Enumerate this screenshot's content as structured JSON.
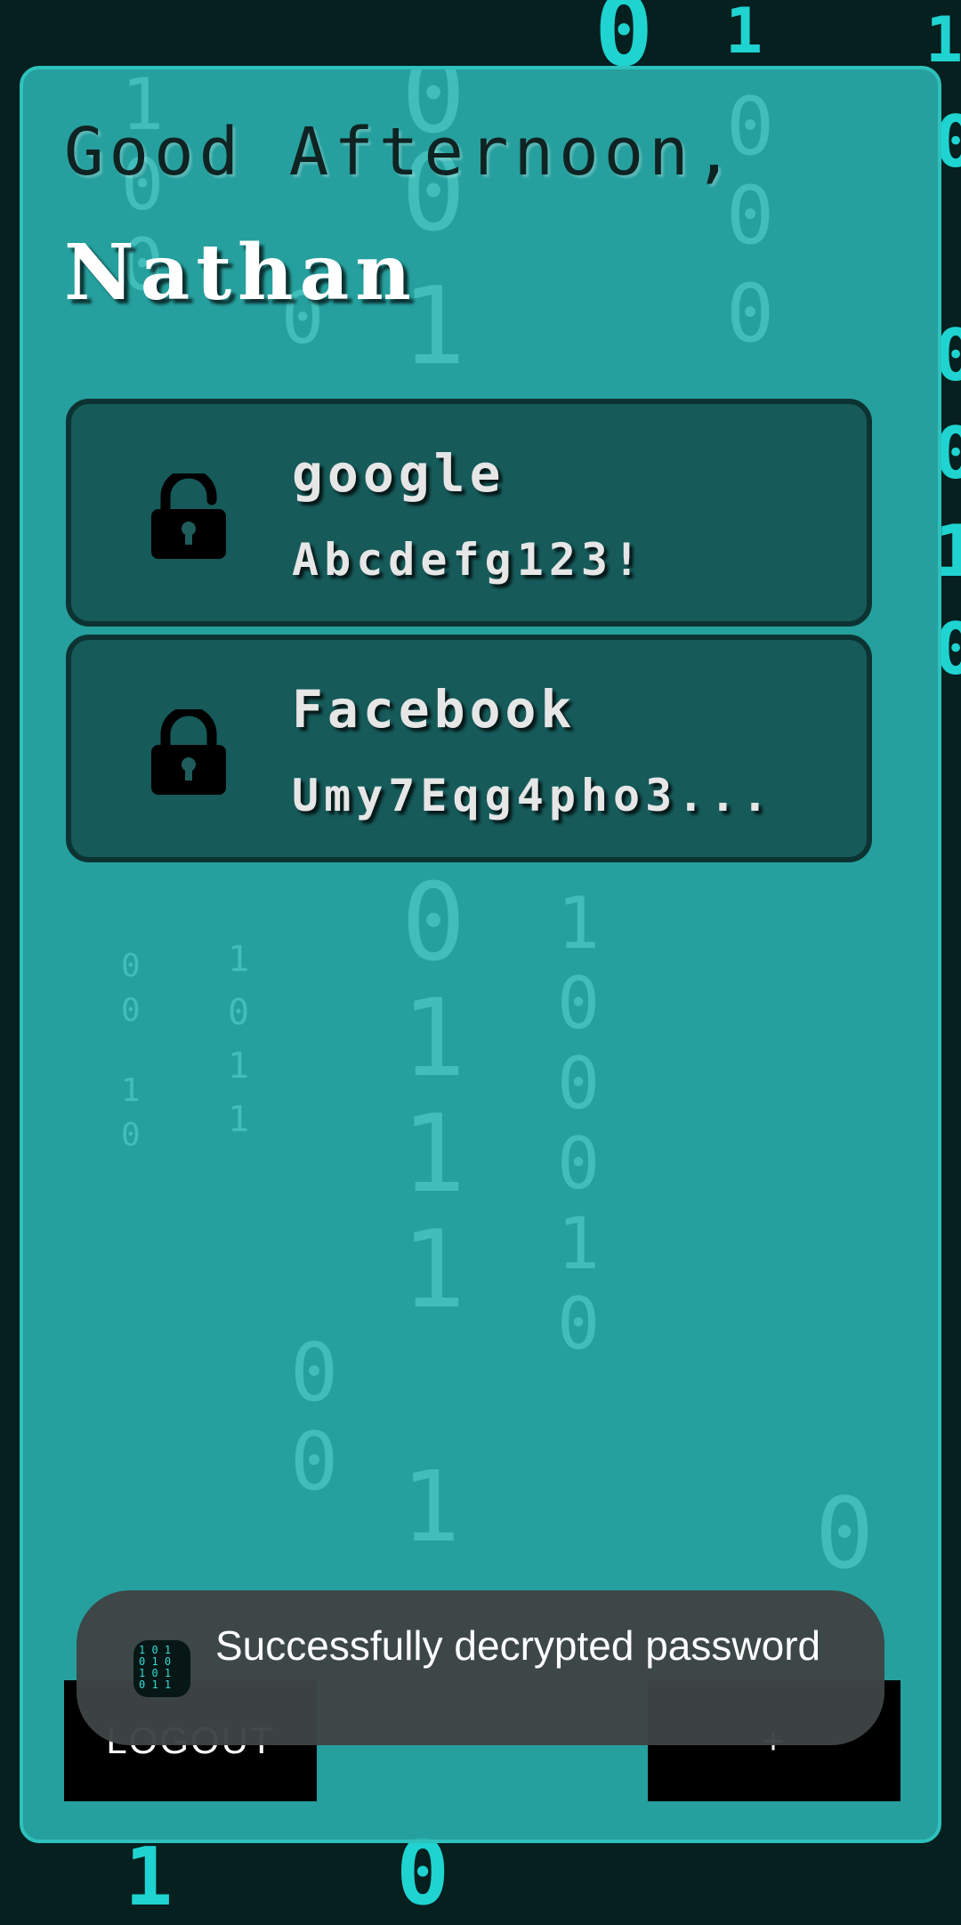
{
  "greeting": {
    "salutation": "Good Afternoon,",
    "user_name": "Nathan"
  },
  "passwords": [
    {
      "site": "google",
      "password": "Abcdefg123!",
      "lock_state": "unlocked",
      "icon": "lock-open-icon"
    },
    {
      "site": "Facebook",
      "password": "Umy7Eqg4pho3...",
      "lock_state": "locked",
      "icon": "lock-icon"
    }
  ],
  "buttons": {
    "logout_label": "LOGOUT",
    "add_label": "+"
  },
  "toast": {
    "message": "Successfully decrypted password",
    "icon": "app-icon"
  },
  "colors": {
    "card_background": "#28aaa8",
    "card_border": "#2ec1bd",
    "item_background": "#124646",
    "button_background": "#000000",
    "toast_background": "#3e4444",
    "accent": "#1fd3d0"
  }
}
